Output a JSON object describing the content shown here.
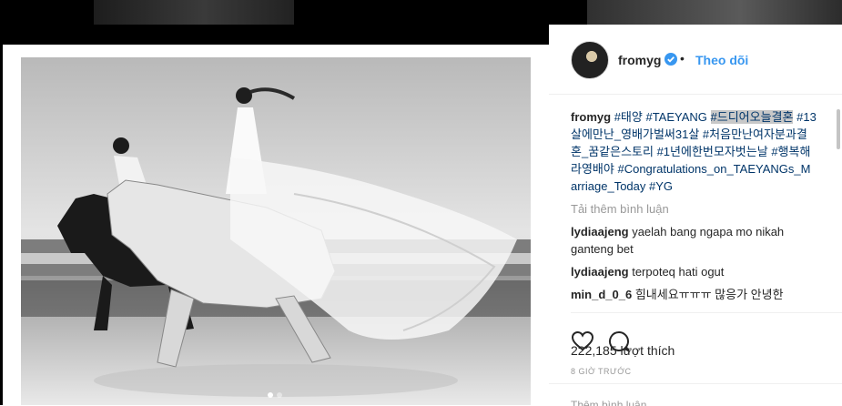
{
  "post": {
    "username": "fromyg",
    "separator": "•",
    "follow_label": "Theo dõi",
    "caption": {
      "user": "fromyg",
      "tags": [
        {
          "text": "#태양",
          "highlight": false
        },
        {
          "text": "#TAEYANG",
          "highlight": false
        },
        {
          "text": "#드디어오늘결혼",
          "highlight": true
        },
        {
          "text": "#13살에만난_영배가벌써31살",
          "highlight": false
        },
        {
          "text": "#처음만난여자분과결혼_꿈같은스토리",
          "highlight": false
        },
        {
          "text": "#1년에한번모자벗는날",
          "highlight": false
        },
        {
          "text": "#행복해라영배야",
          "highlight": false
        },
        {
          "text": "#Congratulations_on_TAEYANGs_Marriage_Today",
          "highlight": false
        },
        {
          "text": "#YG",
          "highlight": false
        }
      ]
    },
    "load_more_label": "Tải thêm bình luận",
    "comments": [
      {
        "user": "lydiaajeng",
        "text": "yaelah bang ngapa mo nikah ganteng bet"
      },
      {
        "user": "lydiaajeng",
        "text": "terpoteq hati ogut"
      },
      {
        "user": "min_d_0_6",
        "text": "힘내세요ㅠㅠㅠ 많응가 안녕한"
      }
    ],
    "likes_label": "222,185 lượt thích",
    "time_label": "8 GIỜ TRƯỚC",
    "add_comment_placeholder": "Thêm bình luận..."
  },
  "carousel": {
    "count": 2,
    "active": 0
  },
  "colors": {
    "link": "#3897f0",
    "hashtag": "#003569",
    "verified": "#3897f0"
  },
  "icons": {
    "verified": "verified-badge-icon",
    "like": "heart-icon",
    "comment": "comment-bubble-icon"
  }
}
